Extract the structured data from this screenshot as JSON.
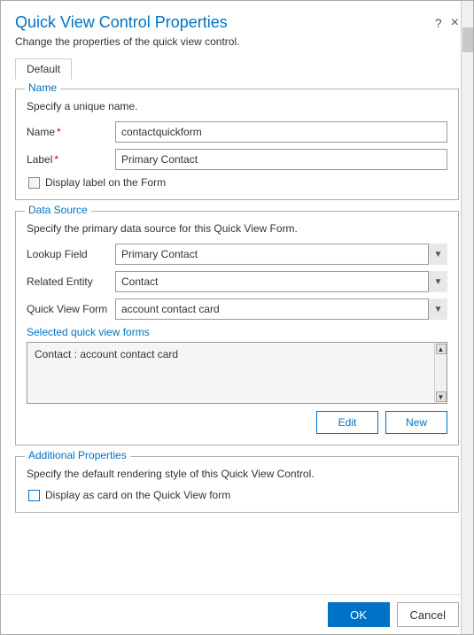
{
  "dialog": {
    "title": "Quick View Control Properties",
    "subtitle": "Change the properties of the quick view control.",
    "help_icon": "?",
    "close_icon": "×"
  },
  "tabs": [
    {
      "label": "Default",
      "active": true
    }
  ],
  "name_section": {
    "legend": "Name",
    "description": "Specify a unique name.",
    "name_label": "Name",
    "name_required": "*",
    "name_value": "contactquickform",
    "label_label": "Label",
    "label_required": "*",
    "label_value": "Primary Contact",
    "checkbox_label": "Display label on the Form"
  },
  "data_source_section": {
    "legend": "Data Source",
    "description": "Specify the primary data source for this Quick View Form.",
    "lookup_field_label": "Lookup Field",
    "lookup_field_value": "Primary Contact",
    "related_entity_label": "Related Entity",
    "related_entity_value": "Contact",
    "quick_view_form_label": "Quick View Form",
    "quick_view_form_value": "account contact card",
    "selected_label": "Selected quick view forms",
    "selected_items": [
      "Contact : account contact card"
    ],
    "edit_button": "Edit",
    "new_button": "New",
    "lookup_options": [
      "Primary Contact"
    ],
    "entity_options": [
      "Contact"
    ],
    "form_options": [
      "account contact card"
    ]
  },
  "additional_section": {
    "legend": "Additional Properties",
    "description": "Specify the default rendering style of this Quick View Control.",
    "checkbox_label": "Display as card on the Quick View form"
  },
  "footer": {
    "ok_label": "OK",
    "cancel_label": "Cancel"
  }
}
